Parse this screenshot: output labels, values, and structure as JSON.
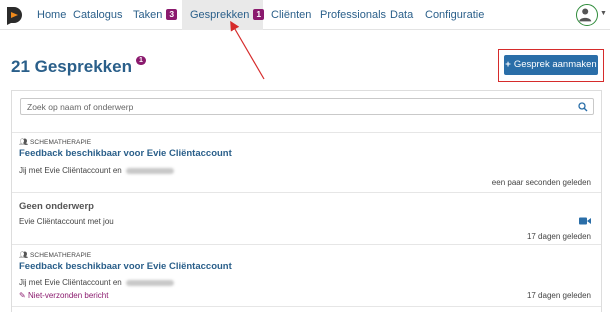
{
  "nav": {
    "items": [
      {
        "label": "Home"
      },
      {
        "label": "Catalogus"
      },
      {
        "label": "Taken",
        "badge": "3"
      },
      {
        "label": "Gesprekken",
        "badge": "1"
      },
      {
        "label": "Cliënten"
      },
      {
        "label": "Professionals"
      },
      {
        "label": "Data"
      },
      {
        "label": "Configuratie"
      }
    ],
    "active": "Gesprekken"
  },
  "header": {
    "title": "21 Gesprekken",
    "badge": "1",
    "add_button": "Gesprek aanmaken"
  },
  "search": {
    "placeholder": "Zoek op naam of onderwerp"
  },
  "conversations": [
    {
      "category": "SCHEMATHERAPIE",
      "title": "Feedback beschikbaar voor Evie Cliëntaccount",
      "participants": "Jij met Evie Cliëntaccount en",
      "time": "een paar seconden geleden"
    },
    {
      "title": "Geen onderwerp",
      "participants": "Evie Cliëntaccount met jou",
      "time": "17 dagen geleden",
      "icon": "video-icon"
    },
    {
      "category": "SCHEMATHERAPIE",
      "title": "Feedback beschikbaar voor Evie Cliëntaccount",
      "participants": "Jij met Evie Cliëntaccount en",
      "draft": "Niet-verzonden bericht",
      "time": "17 dagen geleden"
    }
  ],
  "colors": {
    "accent": "#2a6ea8",
    "badge": "#8b1a6e",
    "annotation": "#d62b2b"
  }
}
